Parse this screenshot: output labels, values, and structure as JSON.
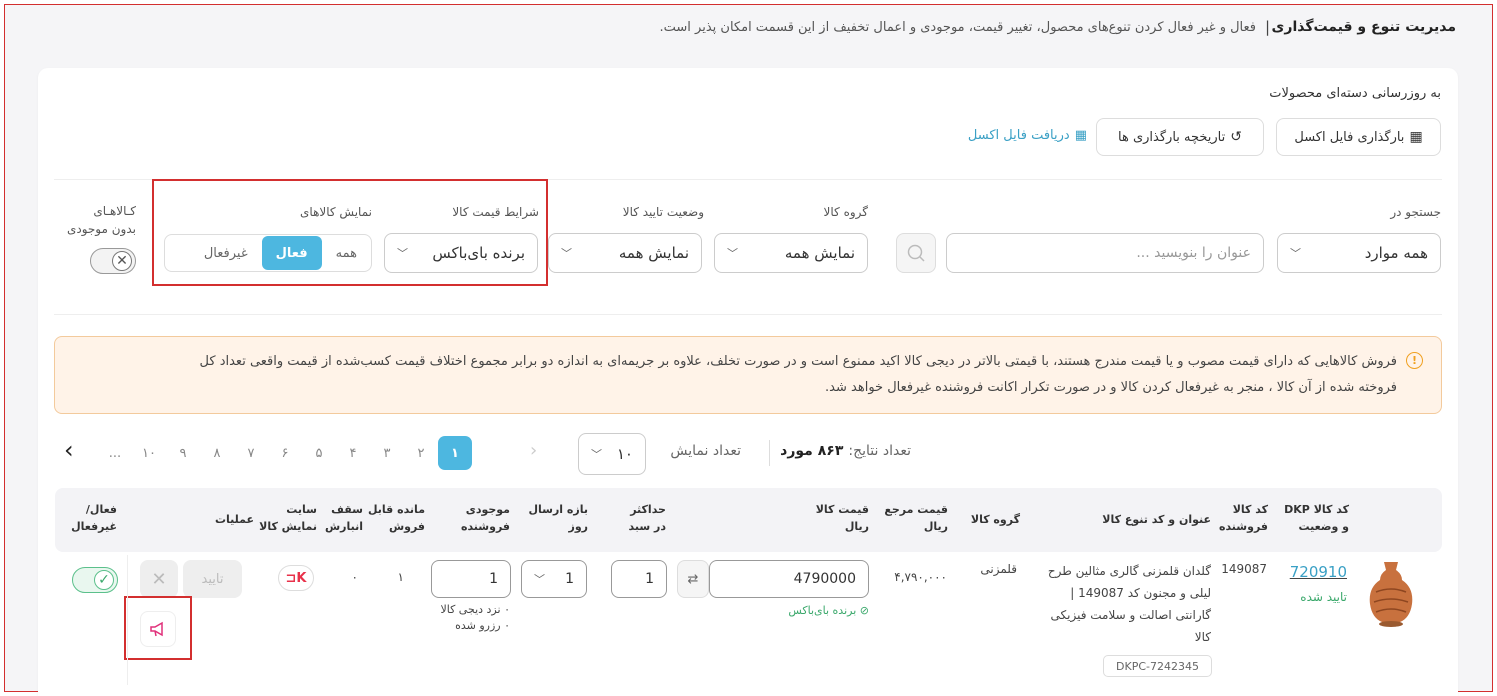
{
  "header": {
    "title": "مدیریت تنوع و قیمت‌گذاری",
    "separator": "|",
    "description": "فعال و غیر فعال کردن تنوع‌های محصول، تغییر قیمت، موجودی و اعمال تخفیف از این قسمت امکان پذیر است."
  },
  "bulk": {
    "title": "به روزرسانی دسته‌ای محصولات",
    "upload_label": "بارگذاری فایل اکسل",
    "history_label": "تاریخچه بارگذاری ها",
    "download_label": "دریافت فایل اکسل"
  },
  "filters": {
    "search_in_label": "جستجو در",
    "search_in_value": "همه موارد",
    "search_placeholder": "عنوان را بنویسید ...",
    "group_label": "گروه کالا",
    "group_value": "نمایش همه",
    "approval_label": "وضعیت تایید کالا",
    "approval_value": "نمایش همه",
    "price_cond_label": "شرایط قیمت کالا",
    "price_cond_value": "برنده بای‌باکس",
    "show_label": "نمایش کالاهای",
    "show_options": [
      "همه",
      "فعال",
      "غیرفعال"
    ],
    "show_selected": "فعال",
    "no_stock_label_1": "کـالاهـای",
    "no_stock_label_2": "بدون موجودی"
  },
  "alert": {
    "line1": "فروش کالاهایی که دارای قیمت مصوب و یا قیمت مندرج هستند، با قیمتی بالاتر در دیجی کالا اکید ممنوع است و در صورت تخلف، علاوه بر جریمه‌ای به اندازه دو برابر مجموع اختلاف قیمت کسب‌شده از قیمت واقعی تعداد کل",
    "line2": "فروخته شده از آن کالا ، منجر به غیرفعال کردن کالا و در صورت تکرار اکانت فروشنده غیرفعال خواهد شد."
  },
  "results": {
    "count_prefix": "تعداد نتایج:",
    "count_value": "۸۶۳ مورد",
    "per_page_label": "تعداد نمایش",
    "per_page_value": "۱۰",
    "pages": [
      "۱",
      "۲",
      "۳",
      "۴",
      "۵",
      "۶",
      "۷",
      "۸",
      "۹",
      "۱۰",
      "..."
    ],
    "current_page": "۱"
  },
  "table": {
    "headers": {
      "dkp": [
        "کد کالا DKP",
        "و وضعیت"
      ],
      "seller_code": [
        "کد کالا",
        "فروشنده"
      ],
      "title": [
        "عنوان و کد تنوع کالا"
      ],
      "group": [
        "گروه کالا"
      ],
      "ref_price": [
        "قیمت مرجع",
        "ریال"
      ],
      "price": [
        "قیمت کالا",
        "ریال"
      ],
      "max_cart": [
        "حداکثر",
        "در سبد"
      ],
      "ship_days": [
        "بازه ارسال",
        "روز"
      ],
      "stock": [
        "موجودی",
        "فروشنده"
      ],
      "sellable": [
        "مانده قابل",
        "فروش"
      ],
      "warehouse_cap": [
        "سقف",
        "انبارش"
      ],
      "site": [
        "سایت",
        "نمایش کالا"
      ],
      "ops": [
        "عملیات"
      ],
      "active": [
        "فعال/",
        "غیرفعال"
      ]
    },
    "row": {
      "dkp": "720910",
      "status": "تایید شده",
      "seller_code": "149087",
      "title_lines": [
        "گلدان قلمزنی گالری مثالین طرح",
        "لیلی و مجنون کد 149087 |",
        "گارانتی اصالت و سلامت فیزیکی",
        "کالا"
      ],
      "variant_code": "DKPC-7242345",
      "group": "قلمزنی",
      "ref_price": "۴,۷۹۰,۰۰۰",
      "price": "4790000",
      "price_note": "برنده بای‌باکس",
      "max_cart": "1",
      "ship_days": "1",
      "stock": "1",
      "stock_note1": "۰ نزد دیجی کالا",
      "stock_note2": "۰ رزرو شده",
      "sellable": "۱",
      "warehouse_cap": "۰",
      "approve_label": "تایید",
      "active": true
    }
  },
  "colors": {
    "accent": "#4db7e0",
    "highlight": "#d32f2f",
    "success": "#3aa86b",
    "link": "#3aa0c5",
    "alert_bg": "#fff3e8"
  }
}
